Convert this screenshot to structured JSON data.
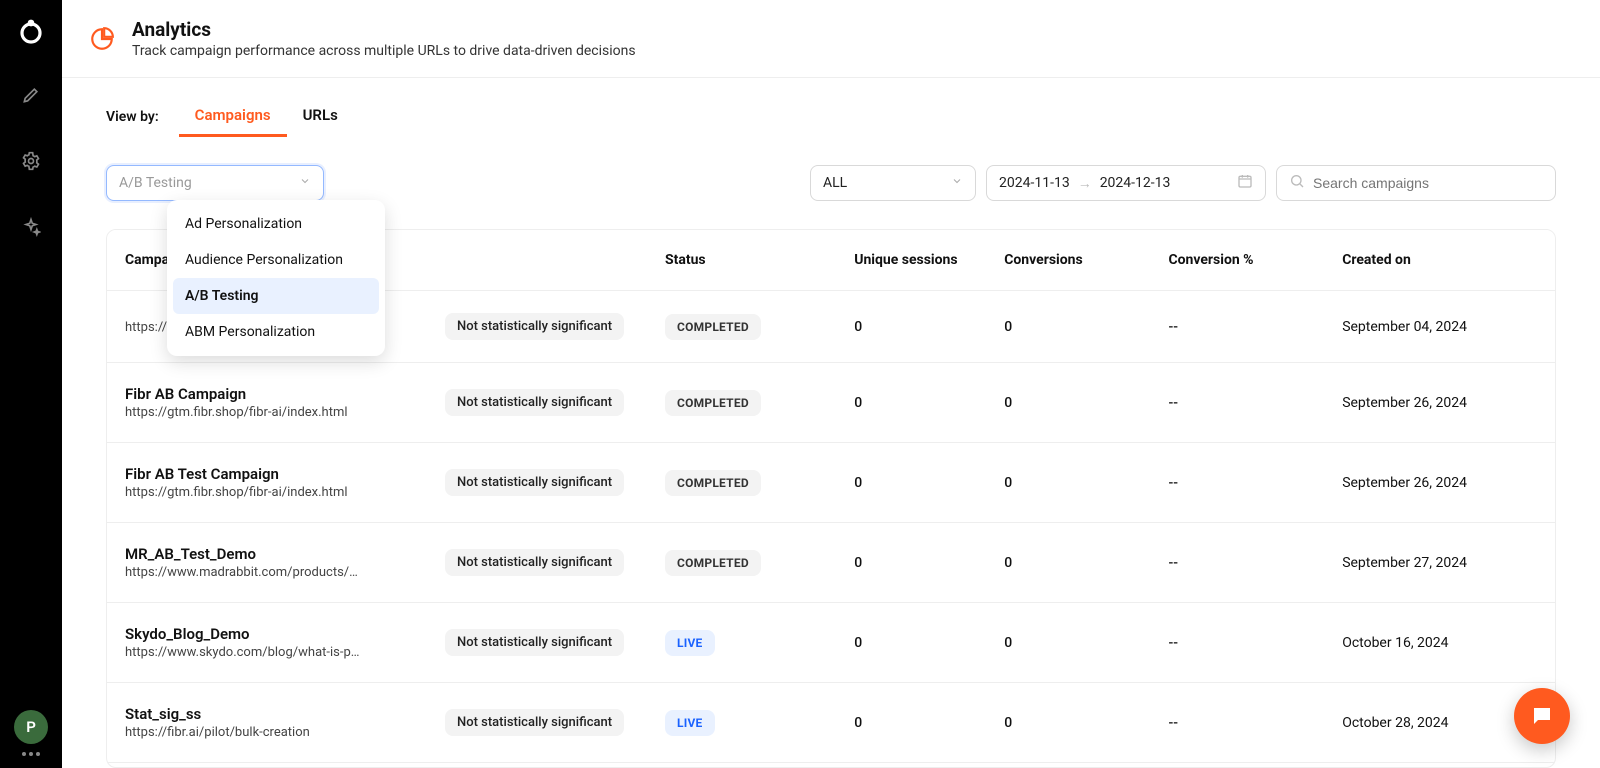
{
  "sidebar": {
    "avatar_initial": "P"
  },
  "header": {
    "title": "Analytics",
    "subtitle": "Track campaign performance across multiple URLs to drive data-driven decisions"
  },
  "viewby": {
    "label": "View by:",
    "tabs": [
      {
        "label": "Campaigns",
        "active": true
      },
      {
        "label": "URLs",
        "active": false
      }
    ]
  },
  "filters": {
    "type_select": {
      "placeholder": "A/B Testing",
      "options": [
        "Ad Personalization",
        "Audience Personalization",
        "A/B Testing",
        "ABM Personalization"
      ],
      "selected_index": 2
    },
    "status_select": {
      "value": "ALL"
    },
    "date_range": {
      "start": "2024-11-13",
      "end": "2024-12-13"
    },
    "search": {
      "placeholder": "Search campaigns"
    }
  },
  "table": {
    "columns": [
      "Campaign",
      "",
      "Status",
      "Unique sessions",
      "Conversions",
      "Conversion %",
      "Created on"
    ],
    "rows": [
      {
        "name": "",
        "url": "https://gtm.fibr.shop/fibr-ai/index.html",
        "note": "Not statistically significant",
        "status": "COMPLETED",
        "sessions": "0",
        "conversions": "0",
        "rate": "--",
        "created": "September 04, 2024"
      },
      {
        "name": "Fibr AB Campaign",
        "url": "https://gtm.fibr.shop/fibr-ai/index.html",
        "note": "Not statistically significant",
        "status": "COMPLETED",
        "sessions": "0",
        "conversions": "0",
        "rate": "--",
        "created": "September 26, 2024"
      },
      {
        "name": "Fibr AB Test Campaign",
        "url": "https://gtm.fibr.shop/fibr-ai/index.html",
        "note": "Not statistically significant",
        "status": "COMPLETED",
        "sessions": "0",
        "conversions": "0",
        "rate": "--",
        "created": "September 26, 2024"
      },
      {
        "name": "MR_AB_Test_Demo",
        "url": "https://www.madrabbit.com/products/…",
        "note": "Not statistically significant",
        "status": "COMPLETED",
        "sessions": "0",
        "conversions": "0",
        "rate": "--",
        "created": "September 27, 2024"
      },
      {
        "name": "Skydo_Blog_Demo",
        "url": "https://www.skydo.com/blog/what-is-p…",
        "note": "Not statistically significant",
        "status": "LIVE",
        "sessions": "0",
        "conversions": "0",
        "rate": "--",
        "created": "October 16, 2024"
      },
      {
        "name": "Stat_sig_ss",
        "url": "https://fibr.ai/pilot/bulk-creation",
        "note": "Not statistically significant",
        "status": "LIVE",
        "sessions": "0",
        "conversions": "0",
        "rate": "--",
        "created": "October 28, 2024"
      }
    ]
  }
}
